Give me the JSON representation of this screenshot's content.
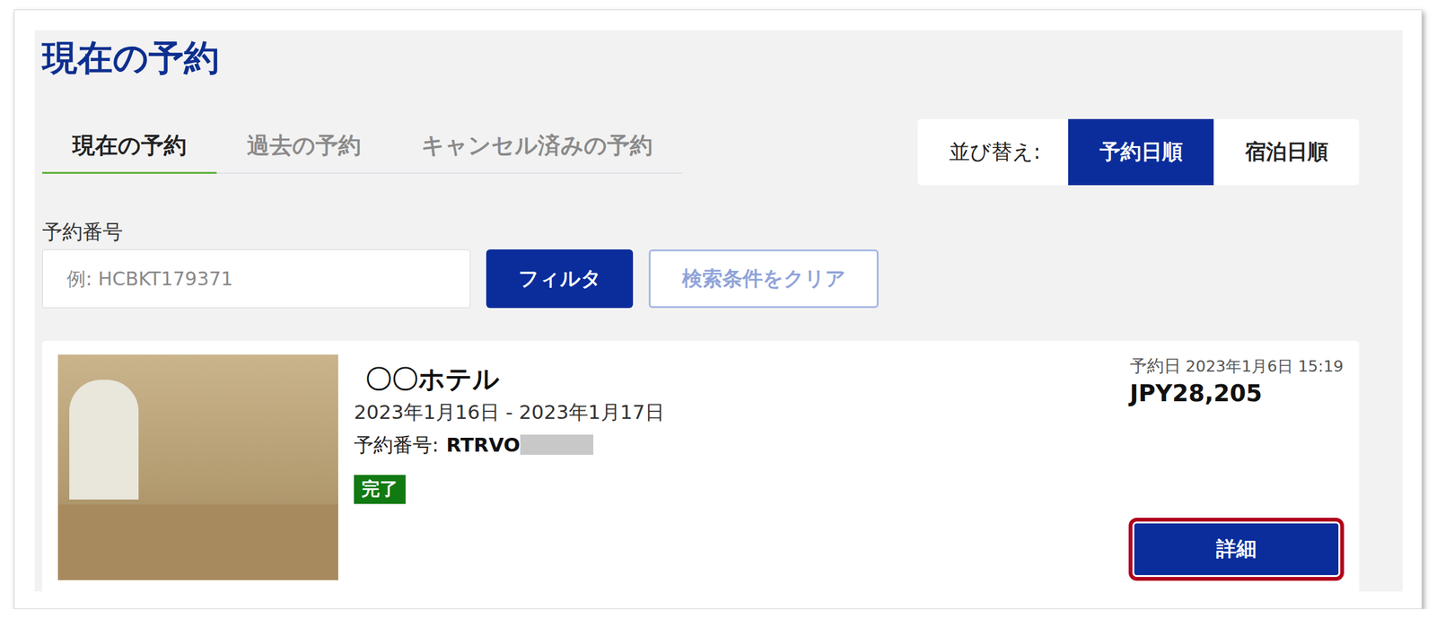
{
  "title": "現在の予約",
  "tabs": [
    {
      "label": "現在の予約",
      "selected": true
    },
    {
      "label": "過去の予約",
      "selected": false
    },
    {
      "label": "キャンセル済みの予約",
      "selected": false
    }
  ],
  "sort": {
    "label": "並び替え:",
    "options": [
      {
        "label": "予約日順",
        "selected": true
      },
      {
        "label": "宿泊日順",
        "selected": false
      }
    ]
  },
  "filter": {
    "label": "予約番号",
    "placeholder": "例: HCBKT179371",
    "value": "",
    "buttons": [
      {
        "label": "フィルタ",
        "kind": "primary"
      },
      {
        "label": "検索条件をクリア",
        "kind": "outline"
      }
    ]
  },
  "reservations": [
    {
      "hotel": "〇〇ホテル",
      "dates": "2023年1月16日 - 2023年1月17日",
      "number_label": "予約番号:",
      "number": "RTRVO",
      "number_masked": true,
      "status": "完了",
      "booked_label": "予約日",
      "booked_at": "2023年1月6日 15:19",
      "price": "JPY28,205",
      "detail_button": {
        "label": "詳細",
        "highlighted": true
      }
    }
  ]
}
